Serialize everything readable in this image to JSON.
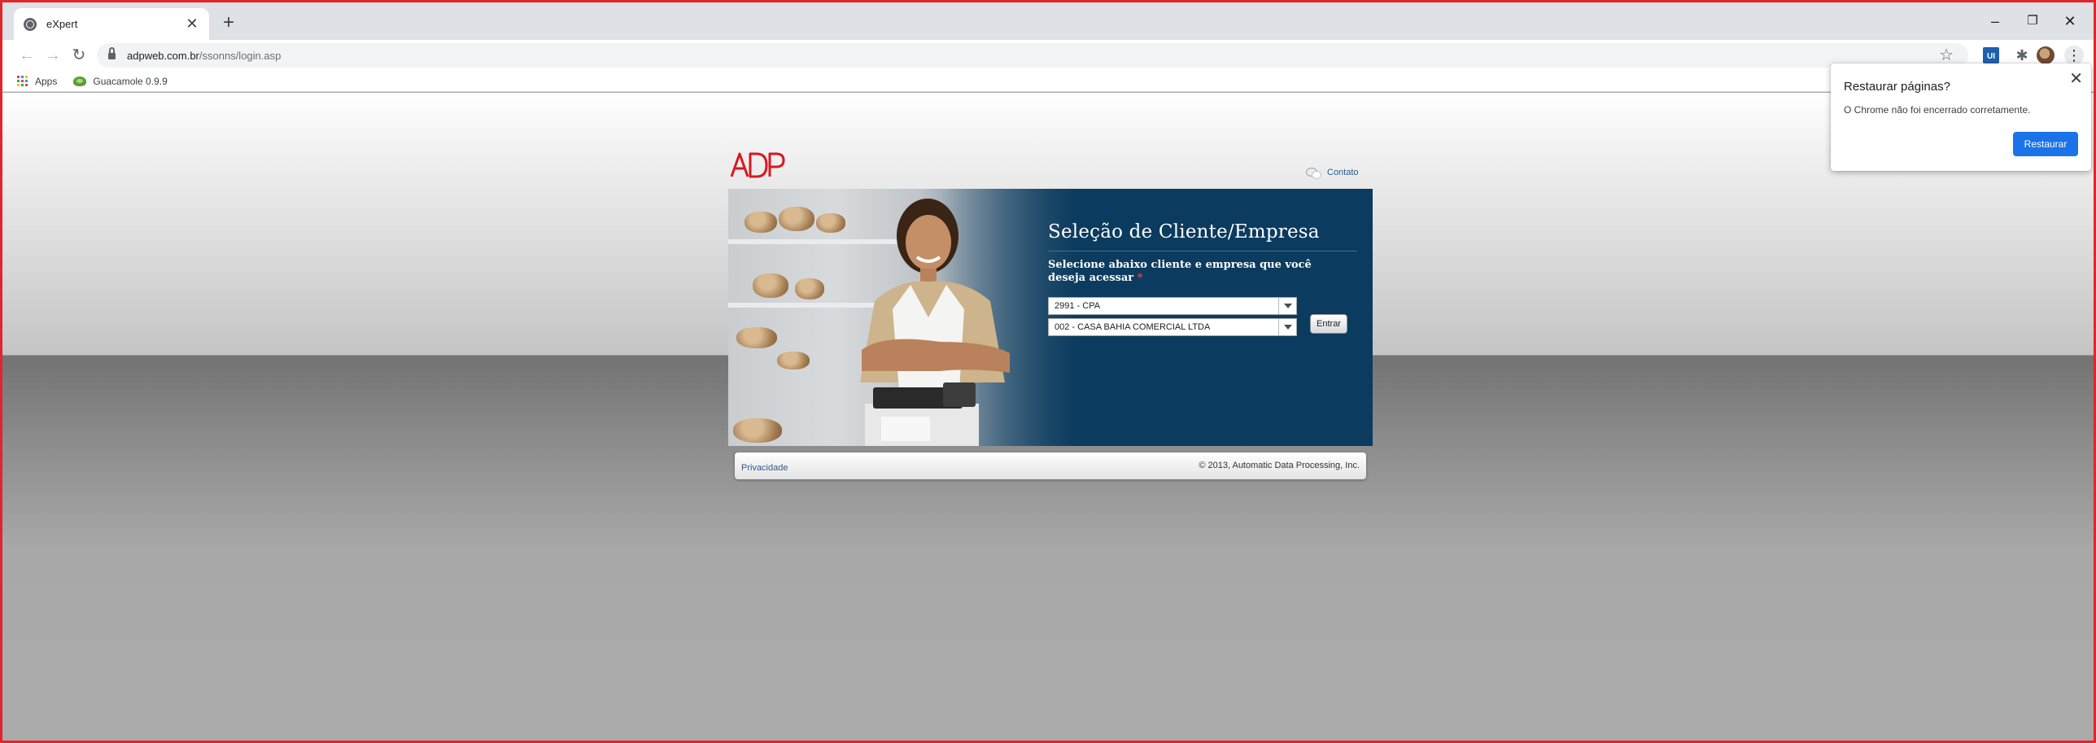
{
  "browser": {
    "tab_title": "eXpert",
    "tab_close": "✕",
    "new_tab": "+",
    "window": {
      "minimize": "–",
      "restore": "❐",
      "close": "✕"
    },
    "url_host": "adpweb.com.br",
    "url_path": "/ssonns/login.asp",
    "nav": {
      "back": "←",
      "forward": "→",
      "reload": "↻"
    },
    "star": "☆",
    "ext_label": "UI",
    "puzzle": "✱",
    "menu": "⋮"
  },
  "bookmarks": {
    "apps_label": "Apps",
    "guacamole_label": "Guacamole 0.9.9"
  },
  "page": {
    "contato_label": "Contato",
    "form_title": "Seleção de Cliente/Empresa",
    "form_instruction": "Selecione abaixo cliente e empresa que você deseja acessar",
    "required_mark": "*",
    "cliente_select_value": "2991 - CPA",
    "empresa_select_value": "002 - CASA BAHIA COMERCIAL LTDA",
    "entrar_label": "Entrar",
    "privacy_label": "Privacidade",
    "copyright": "© 2013, Automatic Data Processing, Inc."
  },
  "popup": {
    "title": "Restaurar páginas?",
    "message": "O Chrome não foi encerrado corretamente.",
    "button_label": "Restaurar",
    "close": "✕"
  },
  "colors": {
    "brand_red": "#d71920",
    "banner_blue": "#0b3b5e",
    "chrome_blue": "#1a73e8"
  }
}
